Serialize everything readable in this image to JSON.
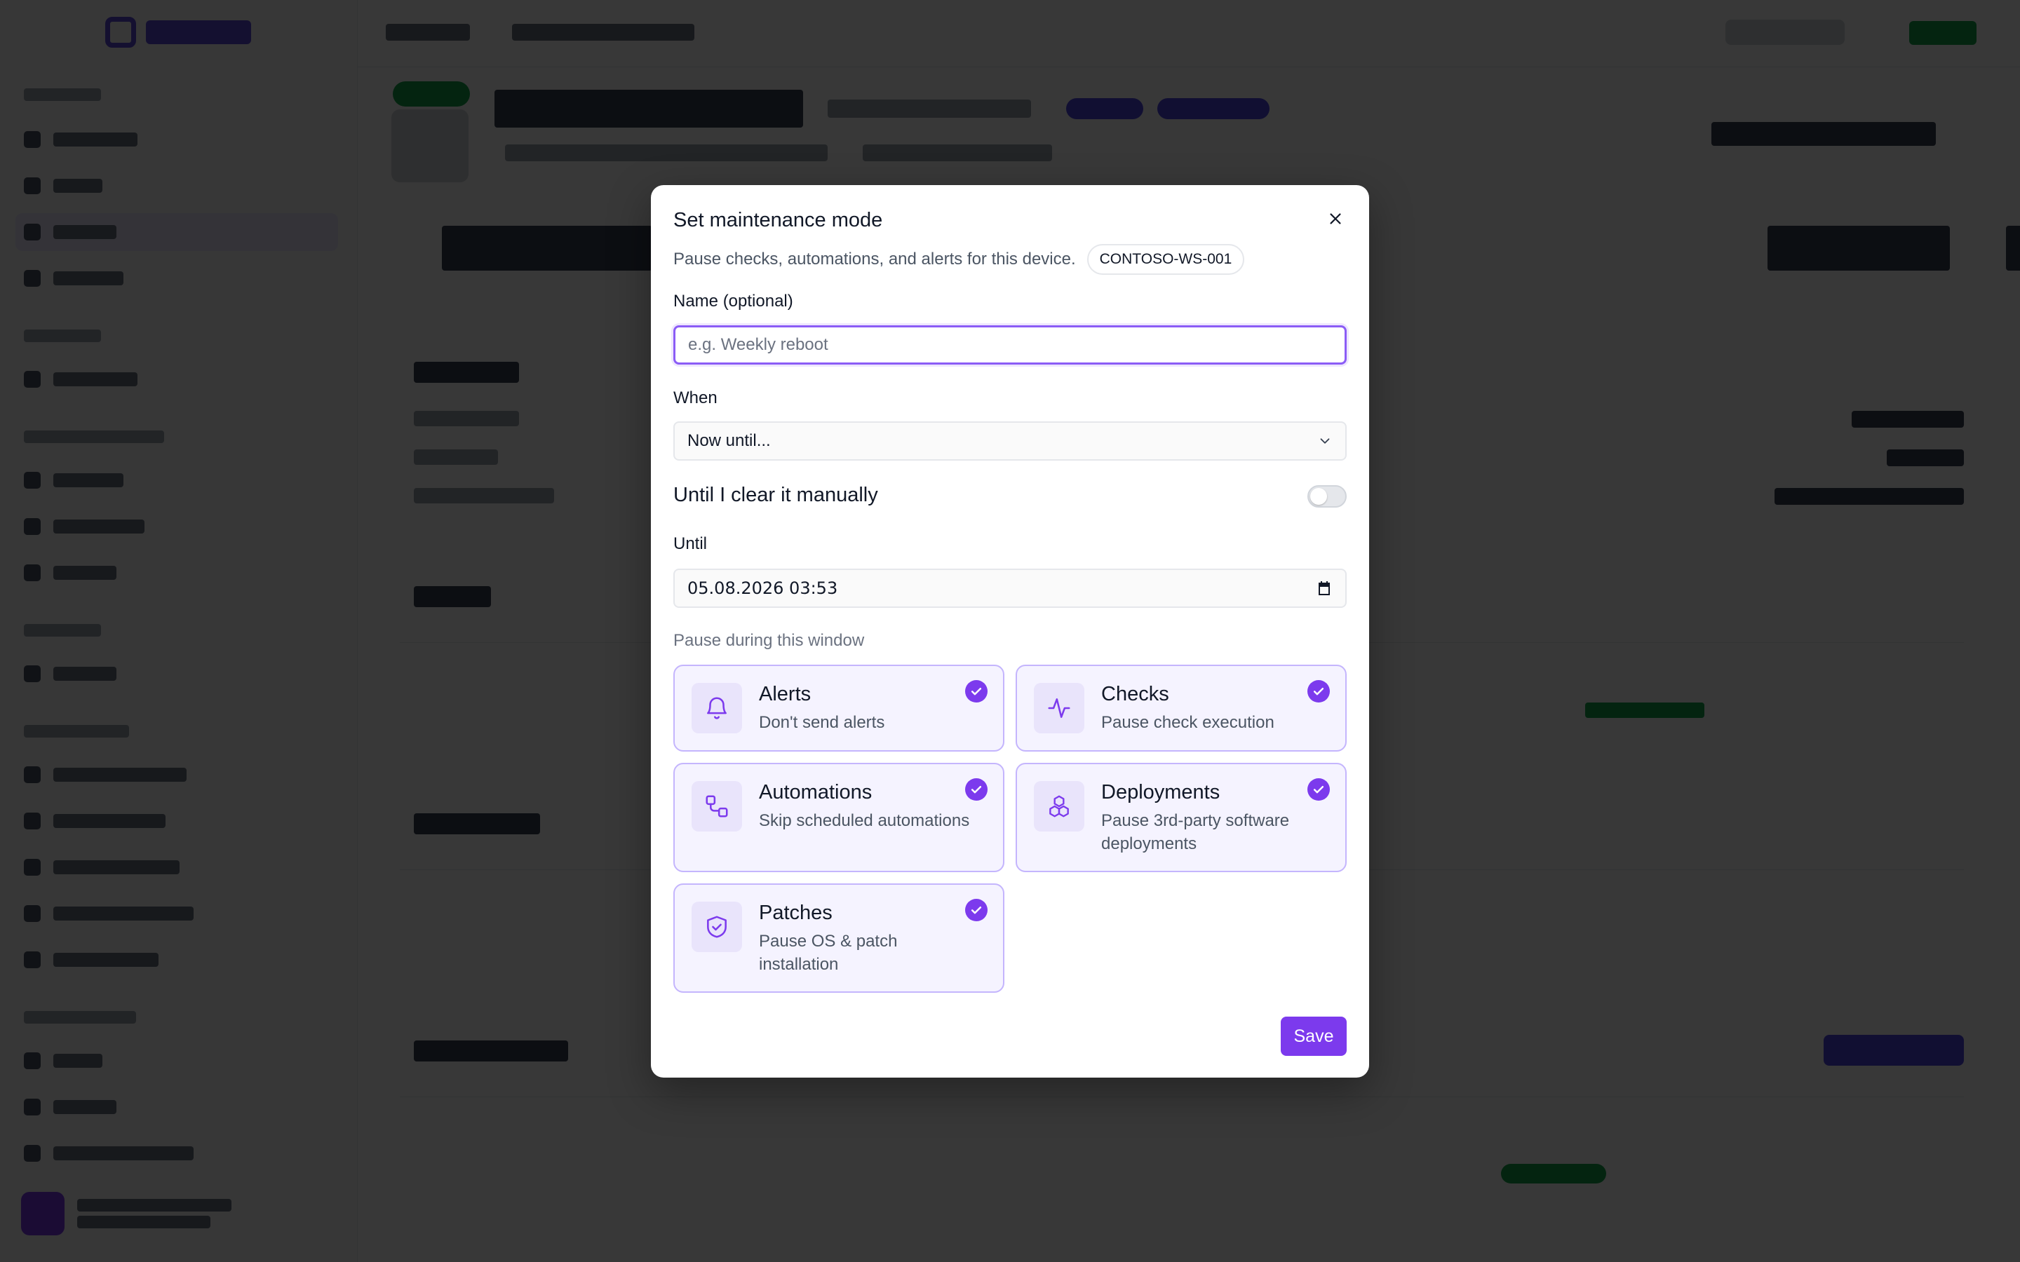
{
  "modal": {
    "title": "Set maintenance mode",
    "description": "Pause checks, automations, and alerts for this device.",
    "device_chip": "CONTOSO-WS-001",
    "close_icon": "close-icon",
    "name_field": {
      "label": "Name (optional)",
      "value": "",
      "placeholder": "e.g. Weekly reboot"
    },
    "when_field": {
      "label": "When",
      "selected": "Now until..."
    },
    "manual_clear": {
      "label": "Until I clear it manually",
      "enabled": false
    },
    "until_field": {
      "label": "Until",
      "value": "05.08.2026 03:53"
    },
    "pause_section_label": "Pause during this window",
    "options": [
      {
        "title": "Alerts",
        "description": "Don't send alerts",
        "icon": "bell-icon",
        "checked": true
      },
      {
        "title": "Checks",
        "description": "Pause check execution",
        "icon": "pulse-icon",
        "checked": true
      },
      {
        "title": "Automations",
        "description": "Skip scheduled automations",
        "icon": "workflow-icon",
        "checked": true
      },
      {
        "title": "Deployments",
        "description": "Pause 3rd-party software deployments",
        "icon": "boxes-icon",
        "checked": true
      },
      {
        "title": "Patches",
        "description": "Pause OS & patch installation",
        "icon": "shield-check-icon",
        "checked": true
      }
    ],
    "save_label": "Save"
  },
  "colors": {
    "accent": "#7c3aed",
    "option_border": "#c4b5fd",
    "option_bg": "#f5f3ff",
    "overlay": "rgba(0,0,0,0.78)"
  }
}
